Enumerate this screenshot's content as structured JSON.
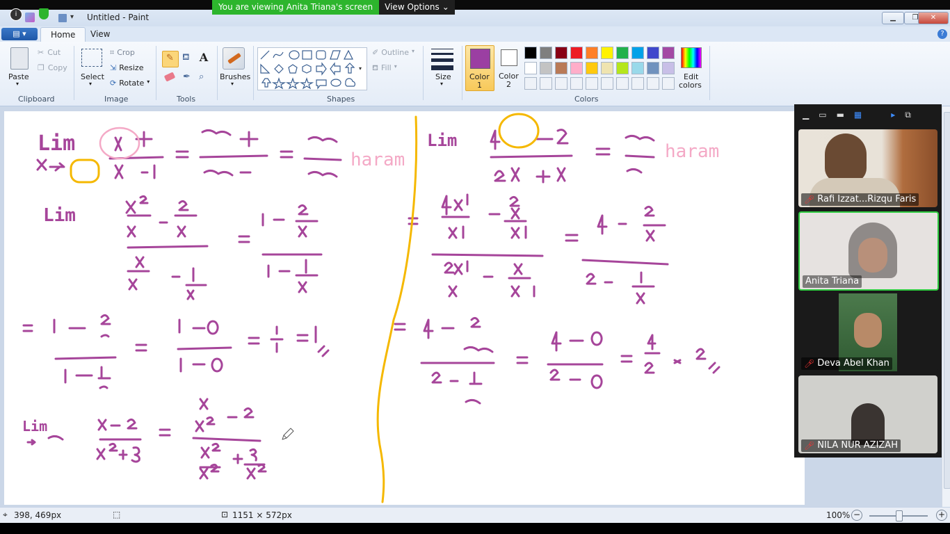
{
  "window": {
    "title": "Untitled - Paint",
    "minimize_label": "▁",
    "restore_label": "❐",
    "close_label": "✕"
  },
  "share_banner": {
    "text": "You are viewing Anita Triana's screen",
    "view_options": "View Options"
  },
  "ribbon": {
    "file_menu": "▤ ▾",
    "tabs": [
      {
        "label": "Home"
      },
      {
        "label": "View"
      }
    ],
    "clipboard": {
      "paste": "Paste",
      "cut": "Cut",
      "copy": "Copy",
      "group": "Clipboard"
    },
    "image": {
      "select": "Select",
      "crop": "Crop",
      "resize": "Resize",
      "rotate": "Rotate",
      "group": "Image"
    },
    "tools": {
      "group": "Tools"
    },
    "brushes": {
      "label": "Brushes"
    },
    "shapes": {
      "outline": "Outline",
      "fill": "Fill",
      "group": "Shapes"
    },
    "size": {
      "label": "Size"
    },
    "colors": {
      "color1_line1": "Color",
      "color1_line2": "1",
      "color2_line1": "Color",
      "color2_line2": "2",
      "edit_line1": "Edit",
      "edit_line2": "colors",
      "group": "Colors",
      "color1": "#9b3fa2",
      "color2": "#ffffff",
      "palette_row1": [
        "#000000",
        "#7f7f7f",
        "#880015",
        "#ed1c24",
        "#ff7f27",
        "#fff200",
        "#22b14c",
        "#00a2e8",
        "#3f48cc",
        "#a349a4"
      ],
      "palette_row2": [
        "#ffffff",
        "#c3c3c3",
        "#b97a57",
        "#ffaec9",
        "#ffc90e",
        "#efe4b0",
        "#b5e61d",
        "#99d9ea",
        "#7092be",
        "#c8bfe7"
      ]
    }
  },
  "participants": [
    {
      "name": "Rafi Izzat...Rizqu Faris",
      "muted": true
    },
    {
      "name": "Anita Triana",
      "muted": false
    },
    {
      "name": "Deva Abel Khan",
      "muted": true
    },
    {
      "name": "NILA NUR AZIZAH",
      "muted": true
    }
  ],
  "status": {
    "cursor_pos": "398, 469px",
    "canvas_size": "1151 × 572px",
    "zoom": "100%"
  },
  "canvas_text": {
    "lim": "Lim",
    "haram": "haram"
  },
  "colors": {
    "ink_purple": "#a6459a",
    "ink_pink": "#f4a9c6",
    "ink_orange": "#f5b800",
    "accent_green": "#2db52d"
  }
}
